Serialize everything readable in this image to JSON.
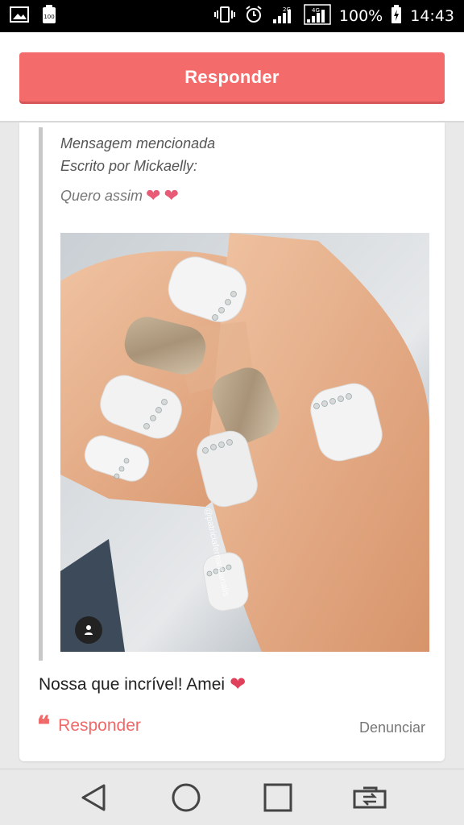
{
  "status_bar": {
    "battery": "100%",
    "time": "14:43",
    "network_1": "2G",
    "network_2": "4G"
  },
  "top": {
    "reply_button": "Responder"
  },
  "quote": {
    "title": "Mensagem mencionada",
    "author": "Escrito por Mickaelly:",
    "text": "Quero assim"
  },
  "photo": {
    "credit": "@patriciafernandanails"
  },
  "comment": {
    "text": "Nossa que incrível! Amei"
  },
  "actions": {
    "reply_label": "Responder",
    "report_label": "Denunciar"
  },
  "colors": {
    "accent": "#f46b6b",
    "heart": "#e85a75"
  }
}
